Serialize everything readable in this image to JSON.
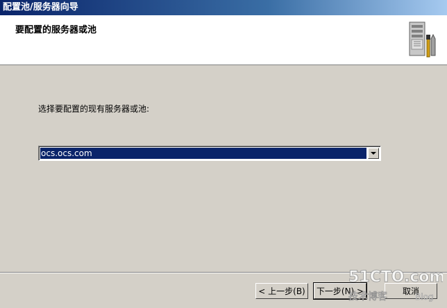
{
  "window": {
    "title": "配置池/服务器向导"
  },
  "header": {
    "title": "要配置的服务器或池",
    "icon": "server-tools-icon"
  },
  "body": {
    "prompt": "选择要配置的现有服务器或池:",
    "select_value": "ocs.ocs.com"
  },
  "buttons": {
    "back_label": "< 上一步(B)",
    "next_label": "下一步(N) >",
    "cancel_label": "取消"
  },
  "watermark": {
    "site": "51CTO.com",
    "tagline": "技术博客",
    "blog": "Blog"
  },
  "colors": {
    "titlebar_start": "#0a246a",
    "titlebar_end": "#a6caf0",
    "dialog_bg": "#d4d0c8",
    "selection": "#0a246a"
  }
}
